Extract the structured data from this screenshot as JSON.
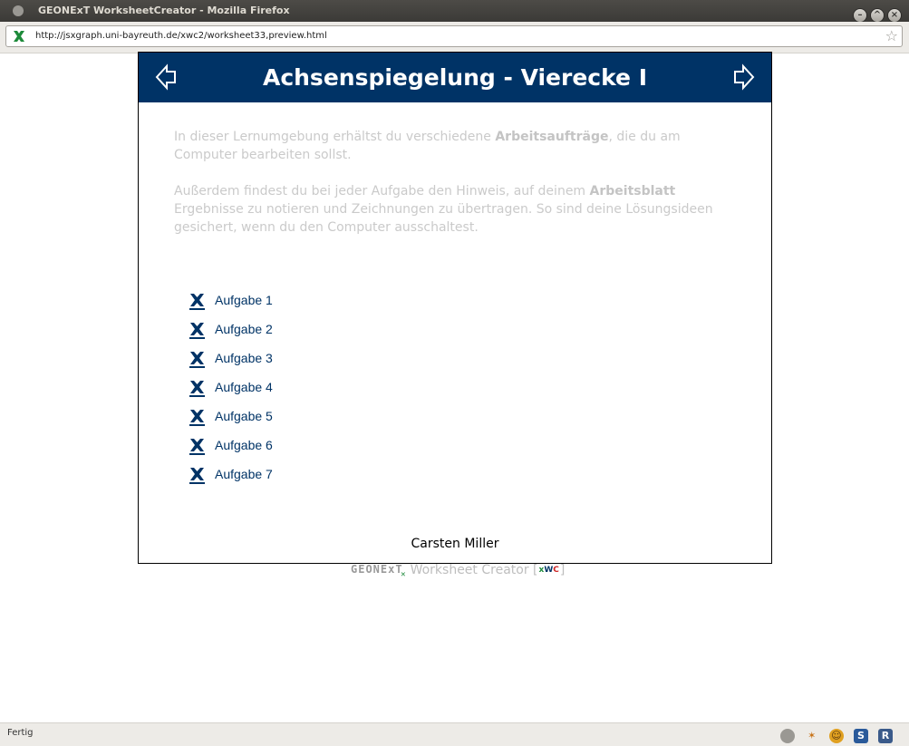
{
  "window": {
    "title": "GEONExT WorksheetCreator - Mozilla Firefox"
  },
  "browser": {
    "url": "http://jsxgraph.uni-bayreuth.de/xwc2/worksheet33,preview.html",
    "status": "Fertig"
  },
  "worksheet": {
    "title": "Achsenspiegelung - Vierecke I",
    "intro1_a": "In dieser Lernumgebung erhältst du verschiedene ",
    "intro1_b": "Arbeitsaufträge",
    "intro1_c": ", die du am Computer bearbeiten sollst.",
    "intro2_a": "Außerdem findest du bei jeder Aufgabe den Hinweis, auf deinem ",
    "intro2_b": "Arbeitsblatt",
    "intro2_c": " Ergebnisse zu notieren und Zeichnungen zu übertragen. So sind deine Lösungsideen gesichert, wenn du den Computer ausschaltest.",
    "tasks": [
      "Aufgabe 1",
      "Aufgabe 2",
      "Aufgabe 3",
      "Aufgabe 4",
      "Aufgabe 5",
      "Aufgabe 6",
      "Aufgabe 7"
    ],
    "author": "Carsten Miller"
  },
  "footer": {
    "logo": "GEONExT",
    "product": "Worksheet Creator",
    "bracket_open": "[",
    "bracket_close": "]",
    "badge_x": "x",
    "badge_w": "W",
    "badge_c": "C"
  },
  "colors": {
    "header_bg": "#003366",
    "link": "#003366",
    "intro_text": "#cacaca"
  }
}
